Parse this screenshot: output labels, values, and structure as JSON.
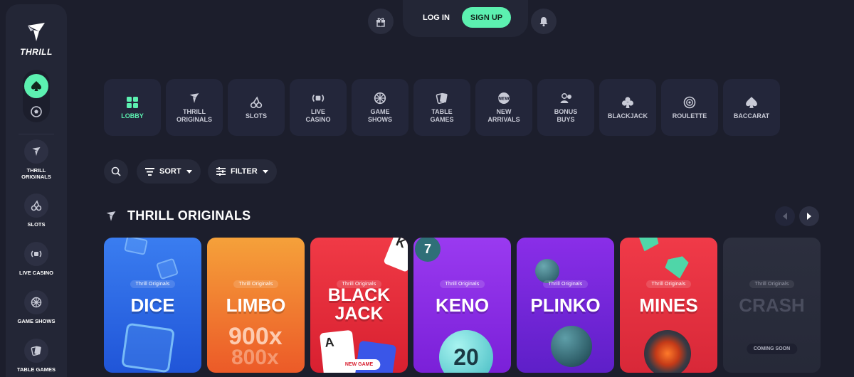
{
  "brand": {
    "name": "THRILL"
  },
  "topbar": {
    "login": "LOG IN",
    "signup": "SIGN UP"
  },
  "sidebar": {
    "items": [
      {
        "label": "THRILL ORIGINALS"
      },
      {
        "label": "SLOTS"
      },
      {
        "label": "LIVE CASINO"
      },
      {
        "label": "GAME SHOWS"
      },
      {
        "label": "TABLE GAMES"
      }
    ]
  },
  "categories": [
    {
      "label": "LOBBY",
      "icon": "grid-icon",
      "active": true
    },
    {
      "label": "THRILL\nORIGINALS",
      "icon": "thrill-icon"
    },
    {
      "label": "SLOTS",
      "icon": "cherries-icon"
    },
    {
      "label": "LIVE\nCASINO",
      "icon": "live-icon"
    },
    {
      "label": "GAME\nSHOWS",
      "icon": "wheel-icon"
    },
    {
      "label": "TABLE\nGAMES",
      "icon": "cards-icon"
    },
    {
      "label": "NEW\nARRIVALS",
      "icon": "new-icon"
    },
    {
      "label": "BONUS\nBUYS",
      "icon": "bonus-icon"
    },
    {
      "label": "BLACKJACK",
      "icon": "club-icon"
    },
    {
      "label": "ROULETTE",
      "icon": "roulette-icon"
    },
    {
      "label": "BACCARAT",
      "icon": "spade-icon"
    }
  ],
  "controls": {
    "sort": "SORT",
    "filter": "FILTER"
  },
  "section": {
    "title": "THRILL ORIGINALS"
  },
  "games": [
    {
      "name": "DICE",
      "tag": "Thrill Originals",
      "color": "#2f6fe8"
    },
    {
      "name": "LIMBO",
      "tag": "Thrill Originals",
      "color": "#f07a2a",
      "multiplier1": "900x",
      "multiplier2": "800x"
    },
    {
      "name": "BLACK JACK",
      "name1": "BLACK",
      "name2": "JACK",
      "tag": "Thrill Originals",
      "color": "#e8303c",
      "card_k": "K",
      "card_a": "A",
      "badge": "NEW GAME"
    },
    {
      "name": "KENO",
      "tag": "Thrill Originals",
      "color": "#8a2ee0",
      "ball_top": "7",
      "ball_main": "20"
    },
    {
      "name": "PLINKO",
      "tag": "Thrill Originals",
      "color": "#7a22d8"
    },
    {
      "name": "MINES",
      "tag": "Thrill Originals",
      "color": "#ea3344"
    },
    {
      "name": "CRASH",
      "tag": "Thrill Originals",
      "color": "#2a2d3c",
      "badge": "COMING SOON"
    }
  ],
  "colors": {
    "accent": "#5cf0b0",
    "background": "#1c1e2c",
    "panel": "#232636"
  }
}
